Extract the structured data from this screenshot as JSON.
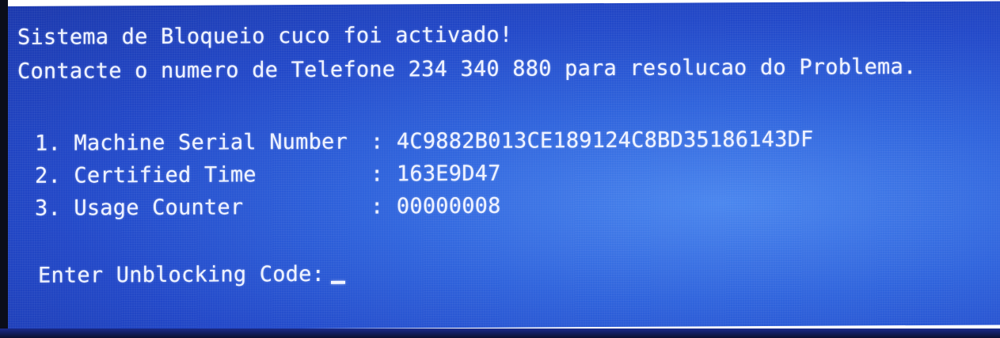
{
  "lock_screen": {
    "title": "Sistema de Bloqueio cuco foi activado!",
    "contact_message": "Contacte o numero de Telefone 234 340 880 para resolucao do Problema.",
    "fields": [
      {
        "label": "1. Machine Serial Number",
        "separator": ": ",
        "value": "4C9882B013CE189124C8BD35186143DF"
      },
      {
        "label": "2. Certified Time",
        "separator": ": ",
        "value": "163E9D47"
      },
      {
        "label": "3. Usage Counter",
        "separator": ": ",
        "value": "00000008"
      }
    ],
    "prompt_label": "Enter Unblocking Code:",
    "input_value": ""
  },
  "colors": {
    "screen_blue": "#2f63dc",
    "text": "#eef2ff",
    "bezel": "#0a0d1a"
  }
}
